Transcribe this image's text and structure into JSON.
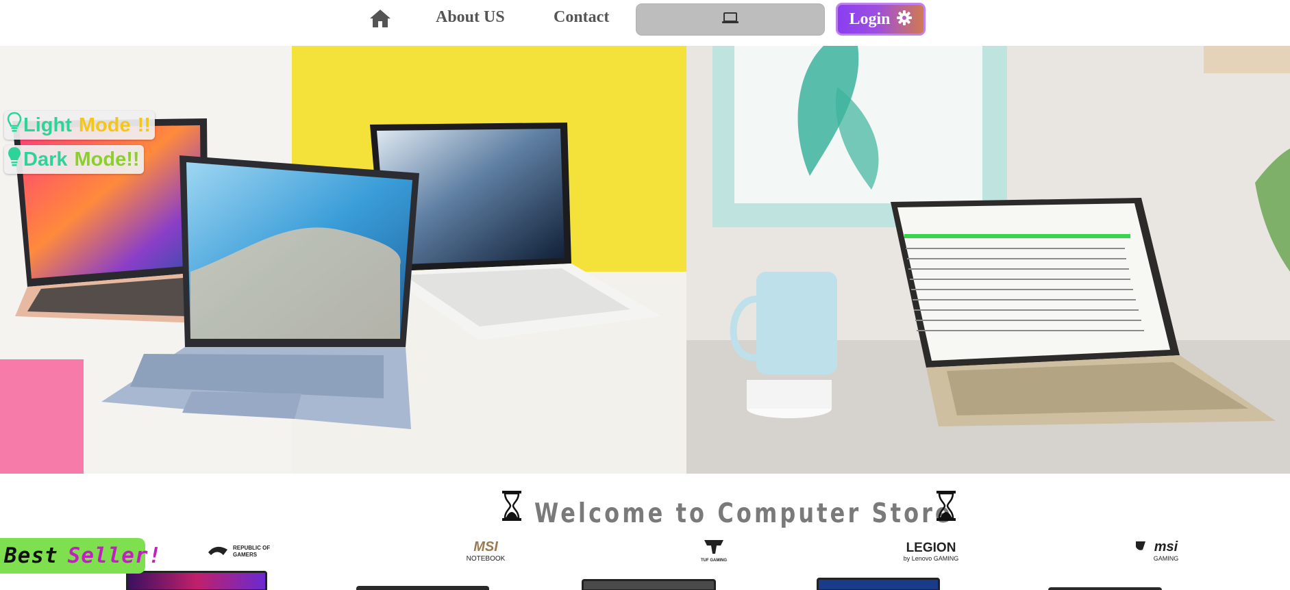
{
  "nav": {
    "home_icon": "home-icon",
    "about_label": "About US",
    "contact_label": "Contact",
    "search_icon": "laptop-icon",
    "login_label": "Login",
    "login_icon": "gear-icon"
  },
  "hero": {
    "left_image": "laptops-on-yellow-background-photo",
    "right_image": "laptop-with-mug-photo"
  },
  "modes": {
    "light": {
      "word1": "Light",
      "word2": "Mode",
      "suffix": "!!",
      "icon": "lightbulb-outline-icon"
    },
    "dark": {
      "word1": "Dark",
      "word2": "Mode!!",
      "icon": "lightbulb-filled-icon"
    }
  },
  "welcome": {
    "title": "Welcome to Computer Store",
    "icon": "hourglass-icon"
  },
  "best_seller": {
    "word1": "Best",
    "word2": "Seller!"
  },
  "brands": [
    {
      "name": "republic-of-gamers-logo",
      "line1": "REPUBLIC OF",
      "line2": "GAMERS"
    },
    {
      "name": "msi-notebook-logo",
      "line1": "MSI",
      "line2": "NOTEBOOK"
    },
    {
      "name": "tuf-gaming-logo",
      "line1": "TUF",
      "line2": "TUF GAMING"
    },
    {
      "name": "legion-logo",
      "line1": "LEGION",
      "line2": "by Lenovo GAMING"
    },
    {
      "name": "msi-gaming-logo",
      "line1": "msi",
      "line2": "GAMING"
    }
  ],
  "colors": {
    "login_gradient_start": "#8a3ff0",
    "login_gradient_end": "#d07a50",
    "light_word": "#2ed39a",
    "mode_word": "#f5c518",
    "dark_word": "#2ed39a",
    "dark_mode_word": "#8ad02a",
    "best_seller_bg": "#7ee04e",
    "seller_word": "#c21fc2"
  }
}
